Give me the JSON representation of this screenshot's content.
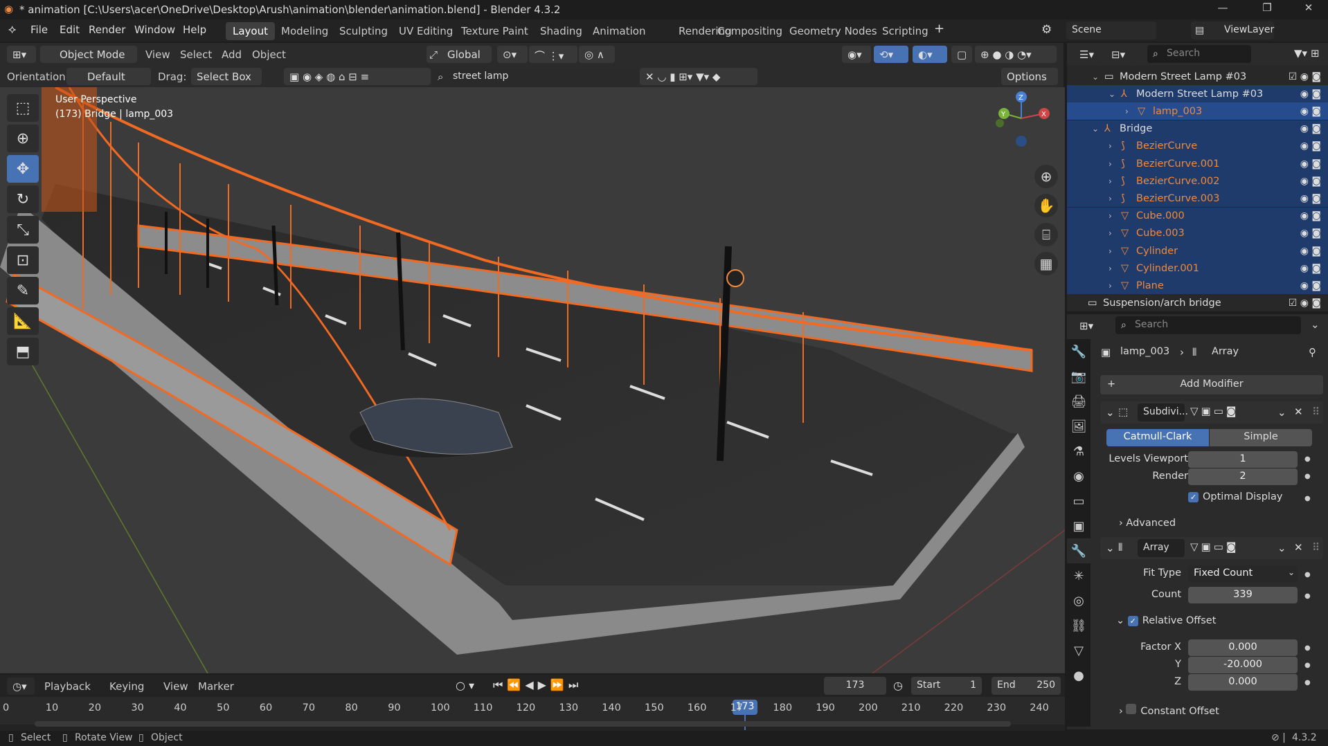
{
  "window": {
    "title": "* animation [C:\\Users\\acer\\OneDrive\\Desktop\\Arush\\animation\\blender\\animation.blend] - Blender 4.3.2",
    "minimize": "—",
    "maximize": "❐",
    "close": "✕"
  },
  "menu": [
    "File",
    "Edit",
    "Render",
    "Window",
    "Help"
  ],
  "workspaces": [
    "Layout",
    "Modeling",
    "Sculpting",
    "UV Editing",
    "Texture Paint",
    "Shading",
    "Animation",
    "Rendering",
    "Compositing",
    "Geometry Nodes",
    "Scripting"
  ],
  "active_workspace": "Layout",
  "scene": {
    "label": "Scene",
    "viewlayer": "ViewLayer"
  },
  "viewport_header": {
    "mode": "Object Mode",
    "menus": [
      "View",
      "Select",
      "Add",
      "Object"
    ],
    "transform": "Global",
    "orientation_label": "Orientation:",
    "orientation": "Default",
    "drag_label": "Drag:",
    "drag": "Select Box",
    "search": "street lamp",
    "options": "Options"
  },
  "viewport": {
    "perspective": "User Perspective",
    "object_info": "(173) Bridge | lamp_003",
    "axes": {
      "x": "X",
      "y": "Y",
      "z": "Z"
    }
  },
  "outliner": {
    "search_placeholder": "Search",
    "items": [
      {
        "name": "Modern Street Lamp #03",
        "indent": 0,
        "type": "collection"
      },
      {
        "name": "Modern Street Lamp #03",
        "indent": 1,
        "type": "empty"
      },
      {
        "name": "lamp_003",
        "indent": 2,
        "type": "mesh",
        "selected": true
      },
      {
        "name": "Bridge",
        "indent": 0,
        "type": "empty"
      },
      {
        "name": "BezierCurve",
        "indent": 1,
        "type": "curve"
      },
      {
        "name": "BezierCurve.001",
        "indent": 1,
        "type": "curve"
      },
      {
        "name": "BezierCurve.002",
        "indent": 1,
        "type": "curve"
      },
      {
        "name": "BezierCurve.003",
        "indent": 1,
        "type": "curve"
      },
      {
        "name": "Cube.000",
        "indent": 1,
        "type": "mesh"
      },
      {
        "name": "Cube.003",
        "indent": 1,
        "type": "mesh"
      },
      {
        "name": "Cylinder",
        "indent": 1,
        "type": "mesh"
      },
      {
        "name": "Cylinder.001",
        "indent": 1,
        "type": "mesh"
      },
      {
        "name": "Plane",
        "indent": 1,
        "type": "mesh"
      },
      {
        "name": "Suspension/arch bridge",
        "indent": -1,
        "type": "collection"
      }
    ]
  },
  "properties": {
    "search_placeholder": "Search",
    "breadcrumb_object": "lamp_003",
    "breadcrumb_modifier": "Array",
    "add_modifier": "Add Modifier",
    "subdivision": {
      "name": "Subdivi...",
      "tab_catmull": "Catmull-Clark",
      "tab_simple": "Simple",
      "levels_viewport_label": "Levels Viewport",
      "levels_viewport": "1",
      "render_label": "Render",
      "render": "2",
      "optimal_display": "Optimal Display",
      "advanced": "Advanced"
    },
    "array": {
      "name": "Array",
      "fit_type_label": "Fit Type",
      "fit_type": "Fixed Count",
      "count_label": "Count",
      "count": "339",
      "relative_offset": "Relative Offset",
      "factor_x_label": "Factor X",
      "factor_x": "0.000",
      "y_label": "Y",
      "y": "-20.000",
      "z_label": "Z",
      "z": "0.000",
      "constant_offset": "Constant Offset"
    }
  },
  "timeline": {
    "menus": [
      "Playback",
      "Keying",
      "View",
      "Marker"
    ],
    "current_frame": "173",
    "start_label": "Start",
    "start": "1",
    "end_label": "End",
    "end": "250",
    "ticks": [
      "0",
      "10",
      "20",
      "30",
      "40",
      "50",
      "60",
      "70",
      "80",
      "90",
      "100",
      "110",
      "120",
      "130",
      "140",
      "150",
      "160",
      "17",
      "180",
      "190",
      "200",
      "210",
      "220",
      "230",
      "240"
    ]
  },
  "statusbar": {
    "select": "Select",
    "rotate": "Rotate View",
    "object": "Object",
    "version": "4.3.2"
  },
  "colors": {
    "accent": "#4772b3",
    "selection": "#f08a3c",
    "active_tab": "#3f3f3f"
  }
}
